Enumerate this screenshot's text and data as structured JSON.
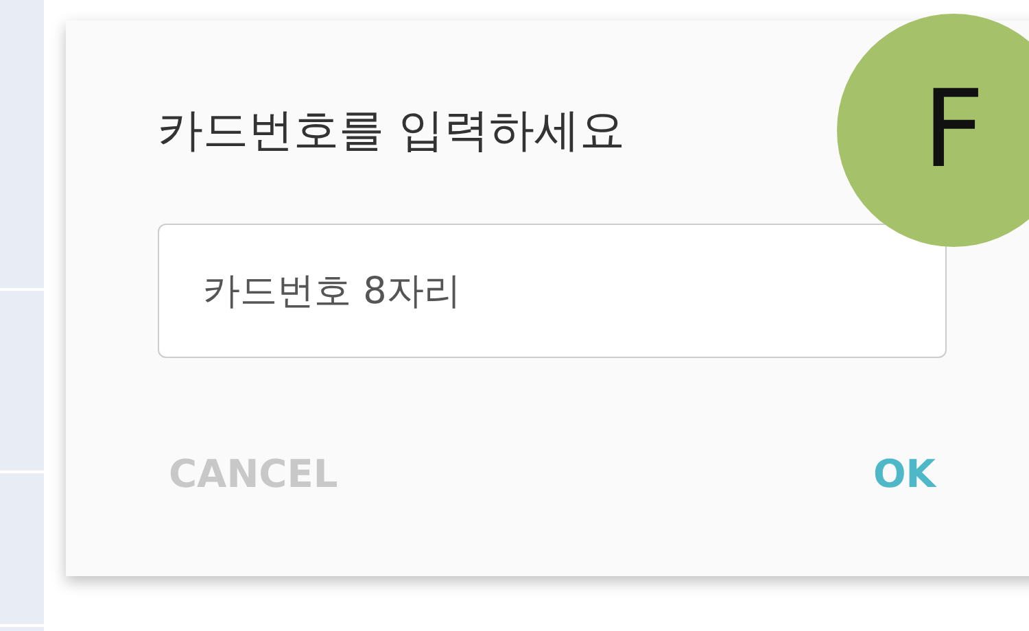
{
  "dialog": {
    "title": "카드번호를 입력하세요",
    "input": {
      "placeholder": "카드번호 8자리"
    },
    "buttons": [
      {
        "label": "CANCEL",
        "disabled": true
      },
      {
        "label": "OK",
        "disabled": false
      }
    ]
  },
  "badge": {
    "label": "F",
    "color": "#a5c26a"
  }
}
